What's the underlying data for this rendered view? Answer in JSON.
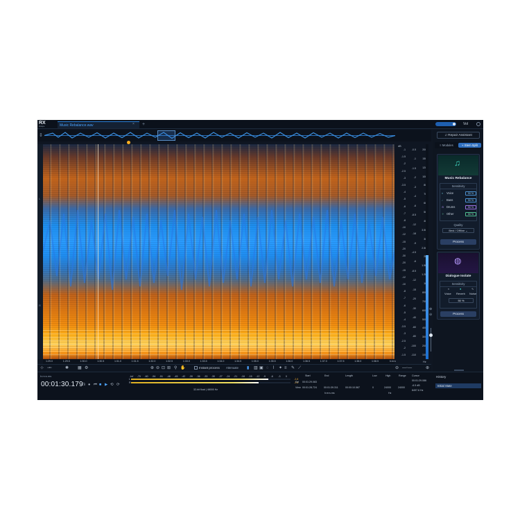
{
  "app": {
    "logo_text": "RX",
    "logo_sub": "iZotope",
    "file_tab": "Music Rebalance.wav",
    "tab_close": "×",
    "tab_add": "+",
    "vol_label": "Vol",
    "accent": "#2a7fd6"
  },
  "side_panel": {
    "repair_assistant": "Repair Assistant",
    "modules_tab": "Modules",
    "stem_split_tab": "Stem Split",
    "music_rebalance": {
      "title": "Music Rebalance",
      "sensitivity_label": "Sensitivity",
      "stems": [
        {
          "label": "Voice",
          "value": "50 %"
        },
        {
          "label": "Bass",
          "value": "50 %"
        },
        {
          "label": "Drums",
          "value": "50 %"
        },
        {
          "label": "Other",
          "value": "50 %"
        }
      ],
      "quality_label": "Quality",
      "quality_value": "Best / Offline",
      "process_label": "Process"
    },
    "dialogue_isolate": {
      "title": "Dialogue Isolate",
      "sensitivity_label": "Sensitivity",
      "options": [
        "Voice",
        "Reverb",
        "Noise"
      ],
      "value": "50 %",
      "process_label": "Process"
    }
  },
  "scales": {
    "db_header": "dB",
    "db_col": [
      "-1",
      "-1.5",
      "-2",
      "-2.5",
      "-3",
      "-3.5",
      "-4",
      "-5",
      "-6",
      "-7",
      "-8",
      "-10",
      "-12",
      "-15",
      "-20",
      "-30",
      "-20",
      "-15",
      "-12",
      "-10",
      "-8",
      "-7",
      "-6",
      "-5",
      "-4",
      "-3.5",
      "-3",
      "-2.5",
      "-2",
      "-1.5"
    ],
    "db_mid": [
      "-0.5",
      "-1",
      "-1.5",
      "-2",
      "-3",
      "-4",
      "-6",
      "-8.5",
      "-12",
      "-18",
      "-9",
      "-4.5",
      "-6",
      "-8.5",
      "-12",
      "-15",
      "-20",
      "-30",
      "-40",
      "-60",
      "-80",
      "-100",
      "-110"
    ],
    "hz_col": [
      "20k",
      "15k",
      "12k",
      "10k",
      "8k",
      "7k",
      "6k",
      "5k",
      "4k",
      "3.5k",
      "3k",
      "2.5k",
      "2k",
      "1.5k",
      "1.2k",
      "1k",
      "800",
      "700",
      "600",
      "500",
      "400",
      "300",
      "200",
      "100"
    ],
    "hz_label": "Hz"
  },
  "ruler": {
    "ticks": [
      "1:29.0",
      "1:29.5",
      "1:30.0",
      "1:30.5",
      "1:31.0",
      "1:31.5",
      "1:32.0",
      "1:32.5",
      "1:33.0",
      "1:33.5",
      "1:34.0",
      "1:34.5",
      "1:35.0",
      "1:35.5",
      "1:36.0",
      "1:36.5",
      "1:37.0",
      "1:37.5",
      "1:38.0",
      "1:38.5"
    ],
    "unit": "h:m:s"
  },
  "toolbar": {
    "instant_process": "Instant process",
    "attenuate": "Attenuate"
  },
  "transport": {
    "time_format": "h:m:s.ms",
    "time": "00:01:30.179",
    "level_scale": [
      "-Inf",
      "-70",
      "-60",
      "-54",
      "-51",
      "-48",
      "-45",
      "-42",
      "-39",
      "-36",
      "-33",
      "-30",
      "-27",
      "-24",
      "-21",
      "-18",
      "-15",
      "-12",
      "-9",
      "-6",
      "-3",
      "0"
    ],
    "ch_L": "L",
    "ch_R": "R",
    "level_L_val": "-3.8",
    "level_R_val": "-3.8",
    "level_L": 0.86,
    "level_R": 0.8,
    "format": "32-bit float | 48000 Hz",
    "selection": {
      "h_start": "Start",
      "h_end": "End",
      "h_length": "Length",
      "sel_label": "Sel",
      "view_label": "View",
      "sel_start": "00:01:29.083",
      "sel_end": "",
      "sel_length": "",
      "view_start": "00:01:28.724",
      "view_end": "00:01:39.311",
      "view_length": "00:00:10.587",
      "unit": "h:m:s.ms"
    },
    "freq": {
      "h_low": "Low",
      "h_high": "High",
      "h_range": "Range",
      "low": "0",
      "high": "24000",
      "range": "24000",
      "unit": "Hz"
    },
    "cursor": {
      "label": "Cursor",
      "time": "00:01:29.086",
      "db": "-6.5 dB",
      "hz": "8497.6 Hz"
    }
  },
  "history": {
    "title": "History",
    "items": [
      "Initial State"
    ]
  }
}
